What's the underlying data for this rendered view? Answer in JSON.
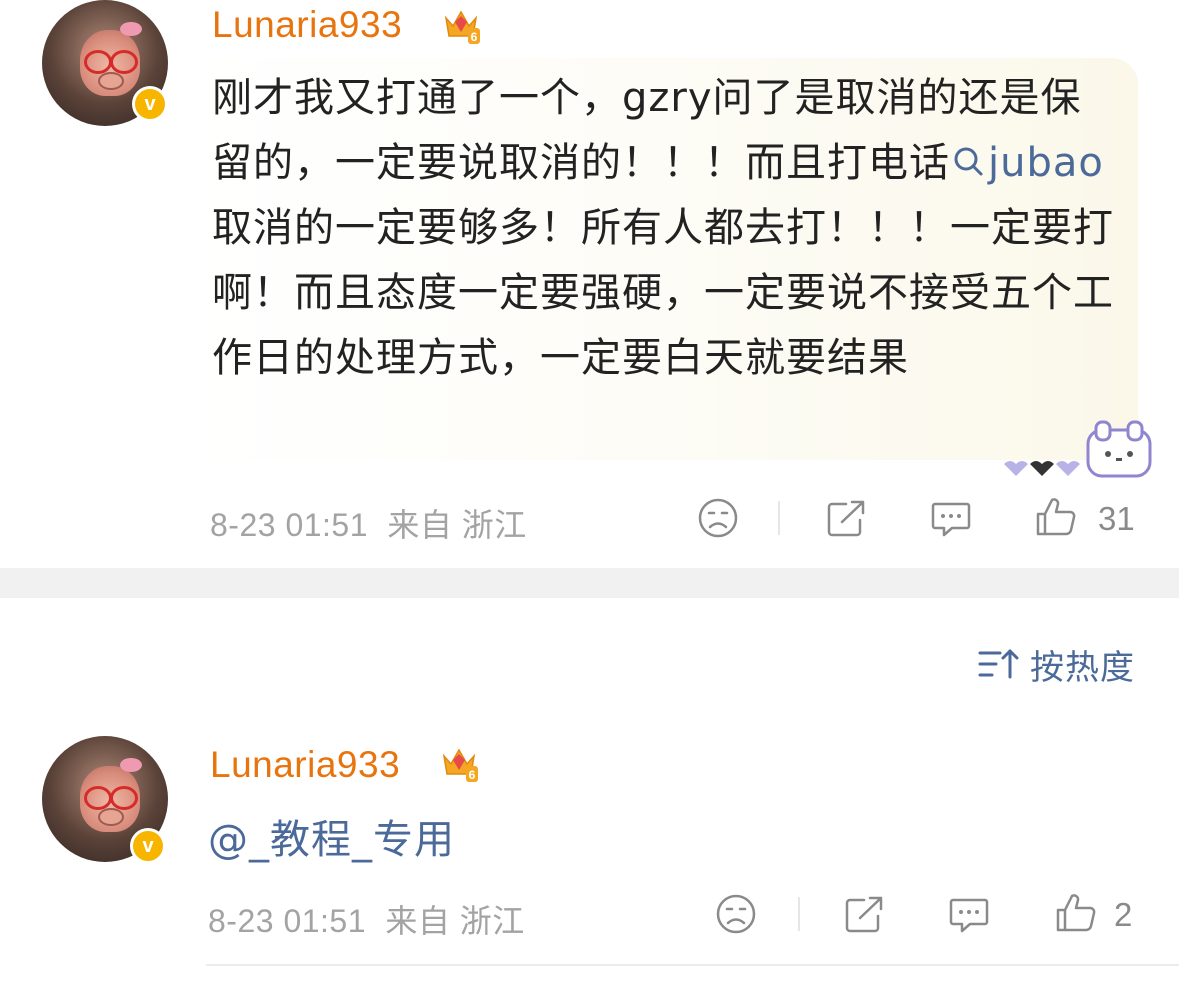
{
  "comment1": {
    "username": "Lunaria933",
    "vip_level": "6",
    "verified_label": "v",
    "text_before_link": "刚才我又打通了一个，gzry问了是取消的还是保留的，一定要说取消的！！！而且打电话",
    "link_text": "jubao",
    "text_after_link": "取消的一定要够多！所有人都去打！！！一定要打啊！而且态度一定要强硬，一定要说不接受五个工作日的处理方式，一定要白天就要结果",
    "timestamp": "8-23 01:51",
    "source": "来自 浙江",
    "like_count": "31"
  },
  "sort": {
    "label": "按热度",
    "icon": "sort-icon"
  },
  "comment2": {
    "username": "Lunaria933",
    "vip_level": "6",
    "verified_label": "v",
    "text": "@_教程_专用",
    "timestamp": "8-23 01:51",
    "source": "来自 浙江",
    "like_count": "2"
  },
  "colors": {
    "username": "#e8740e",
    "link": "#4b6a99",
    "meta": "#a3a3a3",
    "verified": "#f7b500",
    "divider": "#f1f1f1"
  }
}
